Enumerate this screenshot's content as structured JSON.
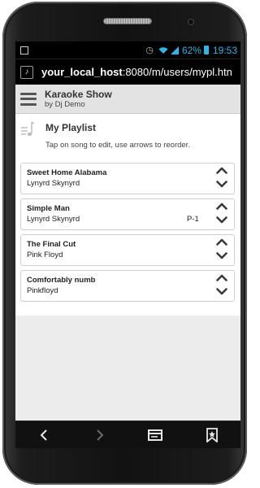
{
  "status_bar": {
    "battery_percent": "62%",
    "time": "19:53"
  },
  "address_bar": {
    "host": "your_local_host",
    "path": ":8080/m/users/mypl.htn"
  },
  "app_header": {
    "title": "Karaoke Show",
    "subtitle": "by Dj Demo"
  },
  "playlist": {
    "title": "My Playlist",
    "instructions": "Tap on song to edit, use arrows to reorder.",
    "songs": [
      {
        "title": "Sweet Home Alabama",
        "artist": "Lynyrd Skynyrd",
        "tag": ""
      },
      {
        "title": "Simple Man",
        "artist": "Lynyrd Skynyrd",
        "tag": "P-1"
      },
      {
        "title": "The Final Cut",
        "artist": "Pink Floyd",
        "tag": ""
      },
      {
        "title": "Comfortably numb",
        "artist": "Pinkfloyd",
        "tag": ""
      }
    ]
  },
  "nav_bar": {
    "items": [
      "back-icon",
      "forward-icon",
      "tabs-icon",
      "bookmark-icon"
    ]
  }
}
